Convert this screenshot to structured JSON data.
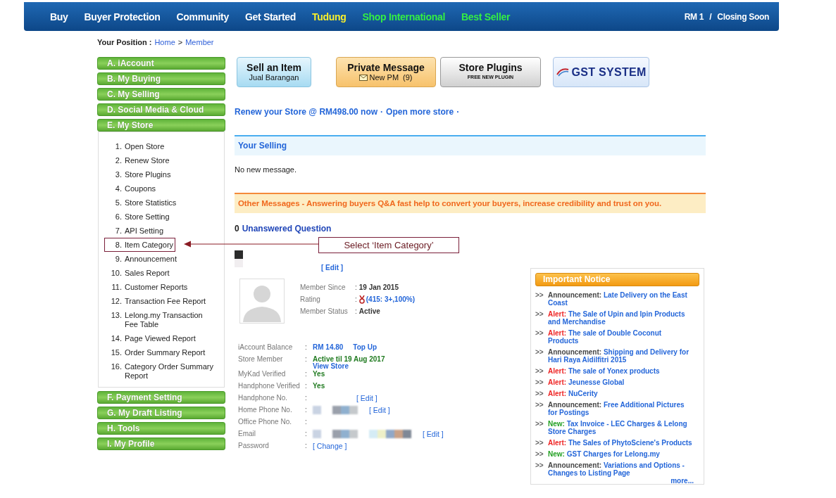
{
  "top_nav": {
    "links": [
      {
        "label": "Buy",
        "kind": "normal"
      },
      {
        "label": "Buyer Protection",
        "kind": "normal"
      },
      {
        "label": "Community",
        "kind": "normal"
      },
      {
        "label": "Get Started",
        "kind": "normal"
      },
      {
        "label": "Tudung",
        "kind": "highlight"
      },
      {
        "label": "Shop International",
        "kind": "promo"
      },
      {
        "label": "Best Seller",
        "kind": "promo"
      }
    ],
    "right": {
      "amount": "RM 1",
      "separator": "/",
      "status": "Closing Soon"
    }
  },
  "breadcrumb": {
    "label": "Your Position :",
    "links": [
      "Home",
      "Member"
    ],
    "separator": ">"
  },
  "sidebar": {
    "sections": [
      {
        "label": "A. iAccount",
        "expanded": false
      },
      {
        "label": "B. My Buying",
        "expanded": false
      },
      {
        "label": "C. My Selling",
        "expanded": false
      },
      {
        "label": "D. Social Media & Cloud",
        "expanded": false
      },
      {
        "label": "E. My Store",
        "expanded": true,
        "children": [
          {
            "number": "1.",
            "label": "Open Store",
            "highlighted": false
          },
          {
            "number": "2.",
            "label": "Renew Store",
            "highlighted": false
          },
          {
            "number": "3.",
            "label": "Store Plugins",
            "highlighted": false
          },
          {
            "number": "4.",
            "label": "Coupons",
            "highlighted": false
          },
          {
            "number": "5.",
            "label": "Store Statistics",
            "highlighted": false
          },
          {
            "number": "6.",
            "label": "Store Setting",
            "highlighted": false
          },
          {
            "number": "7.",
            "label": "API Setting",
            "highlighted": false
          },
          {
            "number": "8.",
            "label": "Item Category",
            "highlighted": true
          },
          {
            "number": "9.",
            "label": "Announcement",
            "highlighted": false
          },
          {
            "number": "10.",
            "label": "Sales Report",
            "highlighted": false
          },
          {
            "number": "11.",
            "label": "Customer Reports",
            "highlighted": false
          },
          {
            "number": "12.",
            "label": "Transaction Fee Report",
            "highlighted": false
          },
          {
            "number": "13.",
            "label": "Lelong.my Transaction Fee Table",
            "highlighted": false
          },
          {
            "number": "14.",
            "label": "Page Viewed Report",
            "highlighted": false
          },
          {
            "number": "15.",
            "label": "Order Summary Report",
            "highlighted": false
          },
          {
            "number": "16.",
            "label": "Category Order Summary Report",
            "highlighted": false
          }
        ]
      },
      {
        "label": "F. Payment Setting",
        "expanded": false
      },
      {
        "label": "G. My Draft Listing",
        "expanded": false
      },
      {
        "label": "H. Tools",
        "expanded": false
      },
      {
        "label": "I. My Profile",
        "expanded": false
      }
    ]
  },
  "annotation": {
    "text": "Select ‘Item Category’"
  },
  "action_buttons": [
    {
      "kind": "sell",
      "title": "Sell an Item",
      "subtitle": "Jual Barangan"
    },
    {
      "kind": "message",
      "title": "Private Message",
      "subtitle": "New PM",
      "count": "(9)"
    },
    {
      "kind": "plugins",
      "title": "Store Plugins",
      "subtitle": "FREE NEW PLUGIN"
    },
    {
      "kind": "gst",
      "title": "GST SYSTEM"
    }
  ],
  "renew_links": {
    "links": [
      "Renew your Store @ RM498.00 now",
      "Open more store"
    ],
    "separator": "·"
  },
  "your_selling": {
    "title": "Your Selling",
    "message": "No new message."
  },
  "other_messages": {
    "title": "Other Messages - Answering buyers Q&A fast help to convert your buyers, increase credibility and trust on you."
  },
  "unanswered": {
    "count": "0",
    "label": "Unanswered Question"
  },
  "banner_edit": "[ Edit ]",
  "member_info": [
    {
      "label": "Member Since",
      "parts": [
        {
          "kind": "strong",
          "text": "19 Jan 2015"
        }
      ]
    },
    {
      "label": "Rating",
      "parts": [
        {
          "kind": "medal"
        },
        {
          "kind": "link",
          "text": "(415: 3+,100%)"
        }
      ]
    },
    {
      "label": "Member Status",
      "parts": [
        {
          "kind": "strong",
          "text": "Active"
        }
      ]
    }
  ],
  "account_rows": [
    {
      "label": "iAccount Balance",
      "parts": [
        {
          "kind": "link",
          "text": "RM 14.80"
        },
        {
          "kind": "link",
          "text": "Top Up"
        }
      ]
    },
    {
      "label": "Store Member",
      "parts": [
        {
          "kind": "green",
          "text": "Active til 19 Aug 2017"
        },
        {
          "kind": "link_below",
          "text": "View Store"
        }
      ]
    },
    {
      "label": "MyKad Verified",
      "parts": [
        {
          "kind": "green",
          "text": "Yes"
        }
      ]
    },
    {
      "label": "Handphone Verified",
      "parts": [
        {
          "kind": "green",
          "text": "Yes"
        }
      ]
    },
    {
      "label": "Handphone No.",
      "parts": [
        {
          "kind": "gap"
        },
        {
          "kind": "edit",
          "text": "[ Edit ]"
        }
      ]
    },
    {
      "label": "Home Phone No.",
      "parts": [
        {
          "kind": "blur"
        },
        {
          "kind": "blur"
        },
        {
          "kind": "edit",
          "text": "[ Edit ]"
        }
      ]
    },
    {
      "label": "Office Phone No.",
      "parts": []
    },
    {
      "label": "Email",
      "parts": [
        {
          "kind": "blur"
        },
        {
          "kind": "blur"
        },
        {
          "kind": "blur"
        },
        {
          "kind": "edit",
          "text": "[ Edit ]"
        }
      ]
    },
    {
      "label": "Password",
      "parts": [
        {
          "kind": "edit",
          "text": "[ Change ]"
        }
      ]
    }
  ],
  "colon": ":",
  "notice": {
    "title": "Important Notice",
    "bullet": ">>",
    "more": "more...",
    "items": [
      {
        "kind": "announcement",
        "label": "Announcement:",
        "title": "Late Delivery on the East Coast"
      },
      {
        "kind": "alert",
        "label": "Alert:",
        "title": "The Sale of Upin and Ipin Products and Merchandise"
      },
      {
        "kind": "alert",
        "label": "Alert:",
        "title": "The sale of Double Coconut Products"
      },
      {
        "kind": "announcement",
        "label": "Announcement:",
        "title": "Shipping and Delivery for Hari Raya Aidilfitri 2015"
      },
      {
        "kind": "alert",
        "label": "Alert:",
        "title": "The sale of Yonex products"
      },
      {
        "kind": "alert",
        "label": "Alert:",
        "title": "Jeunesse Global"
      },
      {
        "kind": "alert",
        "label": "Alert:",
        "title": "NuCerity"
      },
      {
        "kind": "announcement",
        "label": "Announcement:",
        "title": "Free Additional Pictures for Postings"
      },
      {
        "kind": "new",
        "label": "New:",
        "title": "Tax Invoice - LEC Charges & Lelong Store Charges"
      },
      {
        "kind": "alert",
        "label": "Alert:",
        "title": "The Sales of PhytoSciene's Products"
      },
      {
        "kind": "new",
        "label": "New:",
        "title": "GST Charges for Lelong.my"
      },
      {
        "kind": "announcement",
        "label": "Announcement:",
        "title": "Variations and Options - Changes to Listing Page"
      }
    ]
  }
}
